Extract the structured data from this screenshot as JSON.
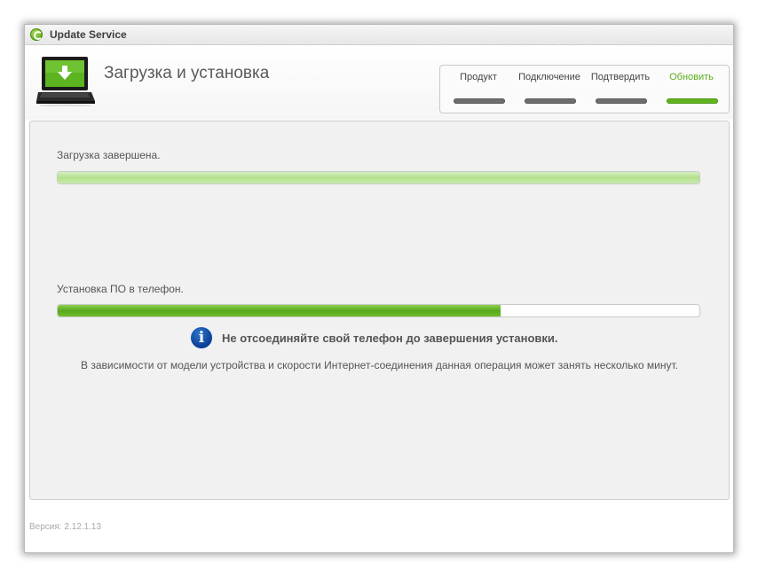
{
  "window": {
    "title": "Update Service"
  },
  "header": {
    "page_title": "Загрузка и установка"
  },
  "steps": [
    {
      "label": "Продукт",
      "active": false
    },
    {
      "label": "Подключение",
      "active": false
    },
    {
      "label": "Подтвердить",
      "active": false
    },
    {
      "label": "Обновить",
      "active": true
    }
  ],
  "download": {
    "label": "Загрузка завершена.",
    "progress": 1.0
  },
  "install": {
    "label": "Установка ПО в телефон.",
    "progress": 0.69
  },
  "info": {
    "icon": "info-icon",
    "warning": "Не отсоединяйте свой телефон до завершения установки.",
    "note": "В зависимости от модели устройства и скорости Интернет-соединения данная операция может занять несколько минут."
  },
  "footer": {
    "version": "Версия: 2.12.1.13"
  },
  "colors": {
    "accent_green": "#62b41f",
    "inactive_step": "#6e6e6e",
    "info_blue": "#0a3e96"
  }
}
